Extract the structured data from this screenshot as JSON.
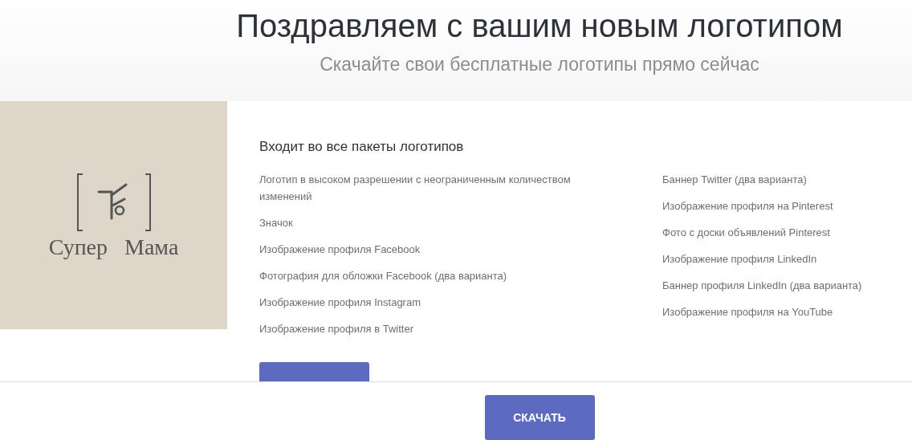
{
  "header": {
    "title": "Поздравляем с вашим новым логотипом",
    "subtitle": "Скачайте свои бесплатные логотипы прямо сейчас"
  },
  "logo": {
    "text": "Супер Мама"
  },
  "package": {
    "heading": "Входит во все пакеты логотипов",
    "column_1": [
      "Логотип в высоком разрешении с неограниченным количеством изменений",
      "Значок",
      "Изображение профиля Facebook",
      "Фотография для обложки Facebook (два варианта)",
      "Изображение профиля Instagram",
      "Изображение профиля в Twitter"
    ],
    "column_2": [
      "Баннер Twitter (два варианта)",
      "Изображение профиля на Pinterest",
      "Фото с доски объявлений Pinterest",
      "Изображение профиля LinkedIn",
      "Баннер профиля LinkedIn (два варианта)",
      "Изображение профиля на YouTube"
    ]
  },
  "footer": {
    "button": "СКАЧАТЬ"
  }
}
